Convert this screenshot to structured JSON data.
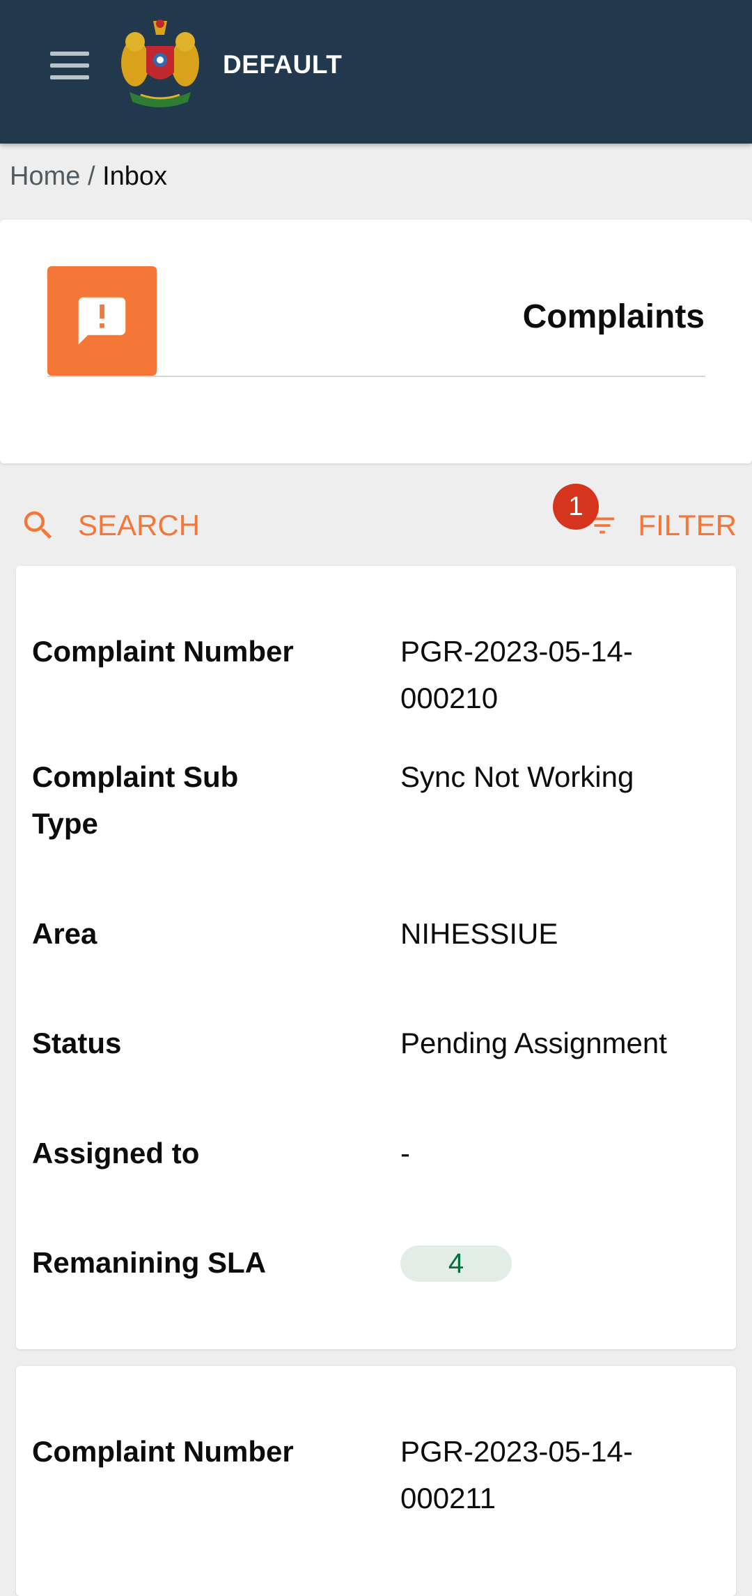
{
  "header": {
    "brand": "DEFAULT",
    "menu_icon": "hamburger-menu-icon",
    "logo": "state-emblem-logo",
    "bg_color": "#22394d"
  },
  "breadcrumb": {
    "home": "Home",
    "separator": "/",
    "current": "Inbox"
  },
  "module_card": {
    "title": "Complaints",
    "icon": "complaint-icon",
    "icon_bg": "#f47738"
  },
  "actions": {
    "search_label": "SEARCH",
    "filter_label": "FILTER",
    "filter_badge": "1",
    "accent_color": "#f47738"
  },
  "complaints": [
    {
      "number_label": "Complaint Number",
      "number": "PGR-2023-05-14-000210",
      "number_line1": "PGR-2023-05-14-",
      "number_line2": "000210",
      "subtype_label_line1": "Complaint Sub",
      "subtype_label_line2": "Type",
      "subtype": "Sync Not Working",
      "area_label": "Area",
      "area": "NIHESSIUE",
      "status_label": "Status",
      "status": "Pending Assignment",
      "assigned_label": "Assigned to",
      "assigned": "-",
      "sla_label": "Remanining SLA",
      "sla": "4"
    },
    {
      "number_label": "Complaint Number",
      "number": "PGR-2023-05-14-000211",
      "number_line1": "PGR-2023-05-14-",
      "number_line2": "000211"
    }
  ]
}
